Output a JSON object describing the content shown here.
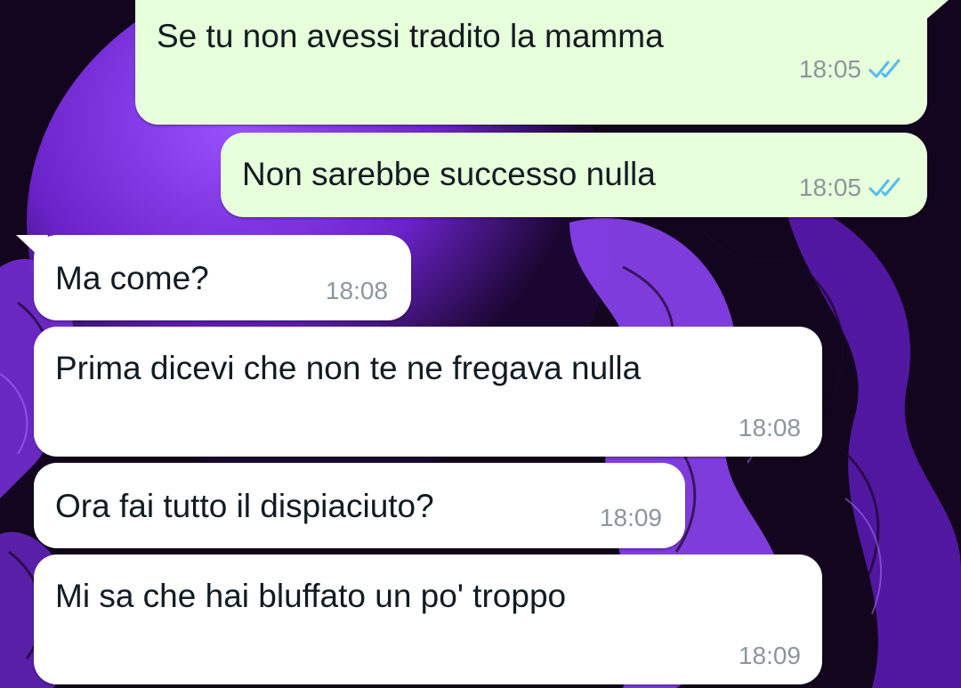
{
  "messages": [
    {
      "direction": "out",
      "text": "Se tu non avessi tradito la mamma",
      "time": "18:05",
      "status": "read"
    },
    {
      "direction": "out",
      "text": "Non sarebbe successo nulla",
      "time": "18:05",
      "status": "read"
    },
    {
      "direction": "in",
      "text": "Ma come?",
      "time": "18:08"
    },
    {
      "direction": "in",
      "text": "Prima dicevi che non te ne fregava nulla",
      "time": "18:08"
    },
    {
      "direction": "in",
      "text": "Ora fai tutto il dispiaciuto?",
      "time": "18:09"
    },
    {
      "direction": "in",
      "text": "Mi sa che hai bluffato un po' troppo",
      "time": "18:09"
    }
  ],
  "colors": {
    "outgoing_bubble": "#e7ffdb",
    "incoming_bubble": "#ffffff",
    "read_ticks": "#53bdeb",
    "timestamp": "#8c969c",
    "wallpaper_accent": "#8a3df0"
  },
  "icons": {
    "read_status": "double-check-icon"
  }
}
